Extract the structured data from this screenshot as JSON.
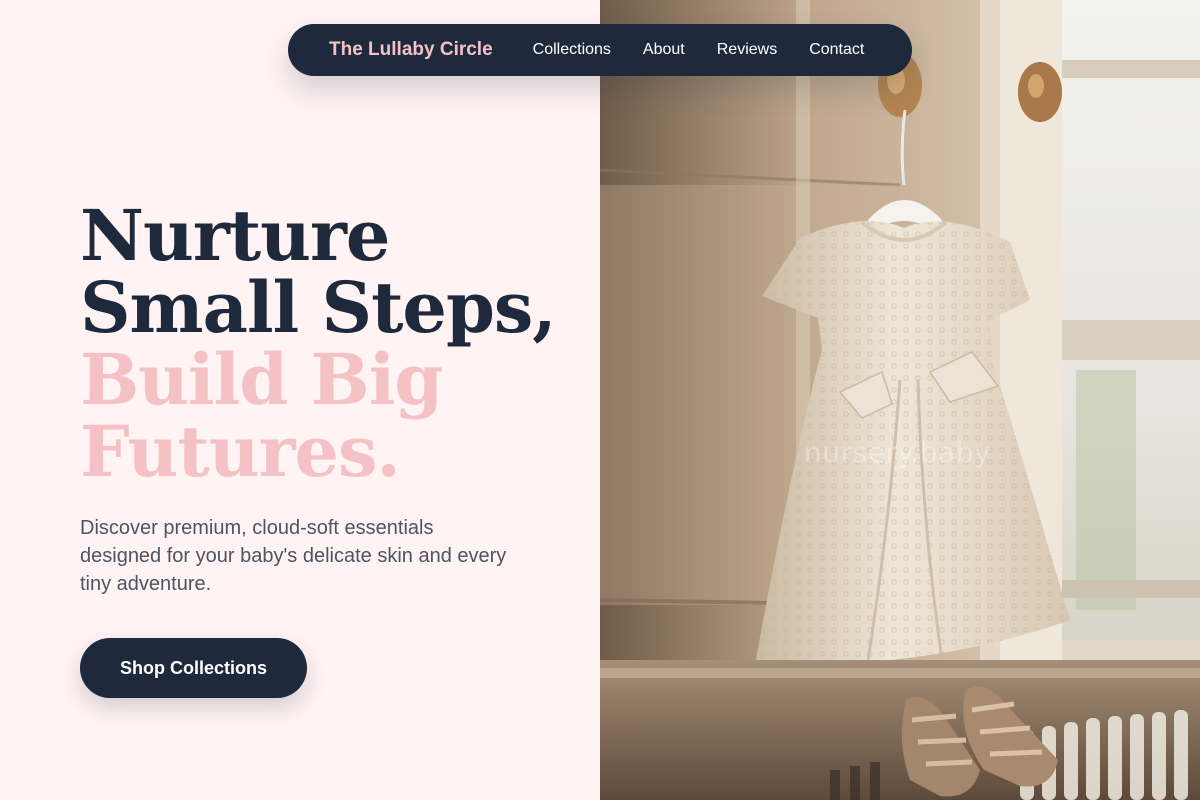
{
  "navbar": {
    "brand": "The Lullaby Circle",
    "links": [
      "Collections",
      "About",
      "Reviews",
      "Contact"
    ]
  },
  "hero": {
    "heading_lines": [
      "Nurture",
      "Small Steps,",
      "Build Big",
      "Futures."
    ],
    "subtitle": "Discover premium, cloud-soft essentials designed for your baby's delicate skin and every tiny adventure.",
    "cta_label": "Shop Collections",
    "image_watermark": "nursery.baby"
  },
  "colors": {
    "background": "#fff3f3",
    "navy": "#1e293b",
    "accent_pink": "#f4c2c4",
    "body_text": "#4b5563"
  }
}
